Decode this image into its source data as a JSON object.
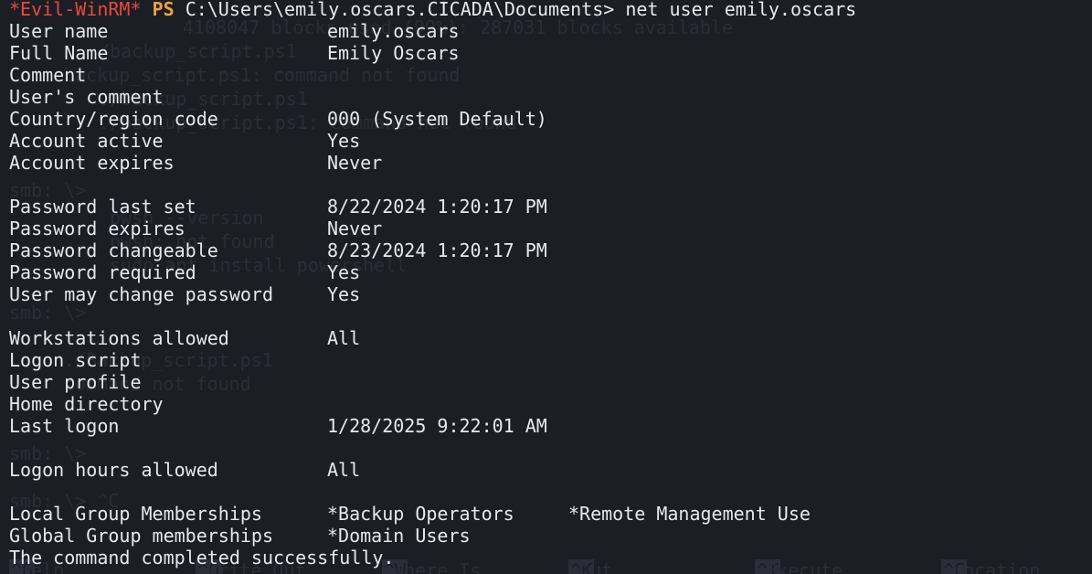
{
  "prompt": {
    "shell_tag": "*Evil-WinRM*",
    "ps": "PS",
    "path": "C:\\Users\\emily.oscars.CICADA\\Documents>",
    "command": "net user emily.oscars"
  },
  "fields": [
    {
      "label": "User name",
      "value": "emily.oscars"
    },
    {
      "label": "Full Name",
      "value": "Emily Oscars"
    },
    {
      "label": "Comment",
      "value": ""
    },
    {
      "label": "User's comment",
      "value": ""
    },
    {
      "label": "Country/region code",
      "value": "000 (System Default)"
    },
    {
      "label": "Account active",
      "value": "Yes"
    },
    {
      "label": "Account expires",
      "value": "Never"
    },
    {
      "label": "",
      "value": ""
    },
    {
      "label": "Password last set",
      "value": "8/22/2024 1:20:17 PM"
    },
    {
      "label": "Password expires",
      "value": "Never"
    },
    {
      "label": "Password changeable",
      "value": "8/23/2024 1:20:17 PM"
    },
    {
      "label": "Password required",
      "value": "Yes"
    },
    {
      "label": "User may change password",
      "value": "Yes"
    },
    {
      "label": "",
      "value": ""
    },
    {
      "label": "Workstations allowed",
      "value": "All"
    },
    {
      "label": "Logon script",
      "value": ""
    },
    {
      "label": "User profile",
      "value": ""
    },
    {
      "label": "Home directory",
      "value": ""
    },
    {
      "label": "Last logon",
      "value": "1/28/2025 9:22:01 AM"
    },
    {
      "label": "",
      "value": ""
    },
    {
      "label": "Logon hours allowed",
      "value": "All"
    },
    {
      "label": "",
      "value": ""
    },
    {
      "label": "Local Group Memberships",
      "value": "*Backup Operators",
      "value2": "*Remote Management Use"
    },
    {
      "label": "Global Group memberships",
      "value": "*Domain Users"
    }
  ],
  "completion": "The command completed successfully.",
  "background_ghost": {
    "lines": [
      "4108047 blocks used (99%): 287031 blocks available",
      "/backup_script.ps1",
      "backup_script.ps1: command not found",
      "./backup_script.ps1",
      "./backup_script.ps1: command not found",
      "smb: \\>",
      "pwsh --version",
      "pwsh: not found",
      "sudo apt install powershell",
      "smb: \\>",
      "./Backup_script.ps1",
      "command not found",
      "smb: \\>",
      "smb: \\> ^C"
    ],
    "menu": [
      "Help",
      "Write Out",
      "Where Is",
      "Cut",
      "Execute",
      "Location"
    ],
    "menu_keys": [
      "^G",
      "^O",
      "^W",
      "^K",
      "^T",
      "^C"
    ]
  },
  "colors": {
    "background": "#1c1e26",
    "foreground": "#e8e8ec",
    "prompt_tag": "#e8483b",
    "prompt_ps": "#f0a13a"
  }
}
